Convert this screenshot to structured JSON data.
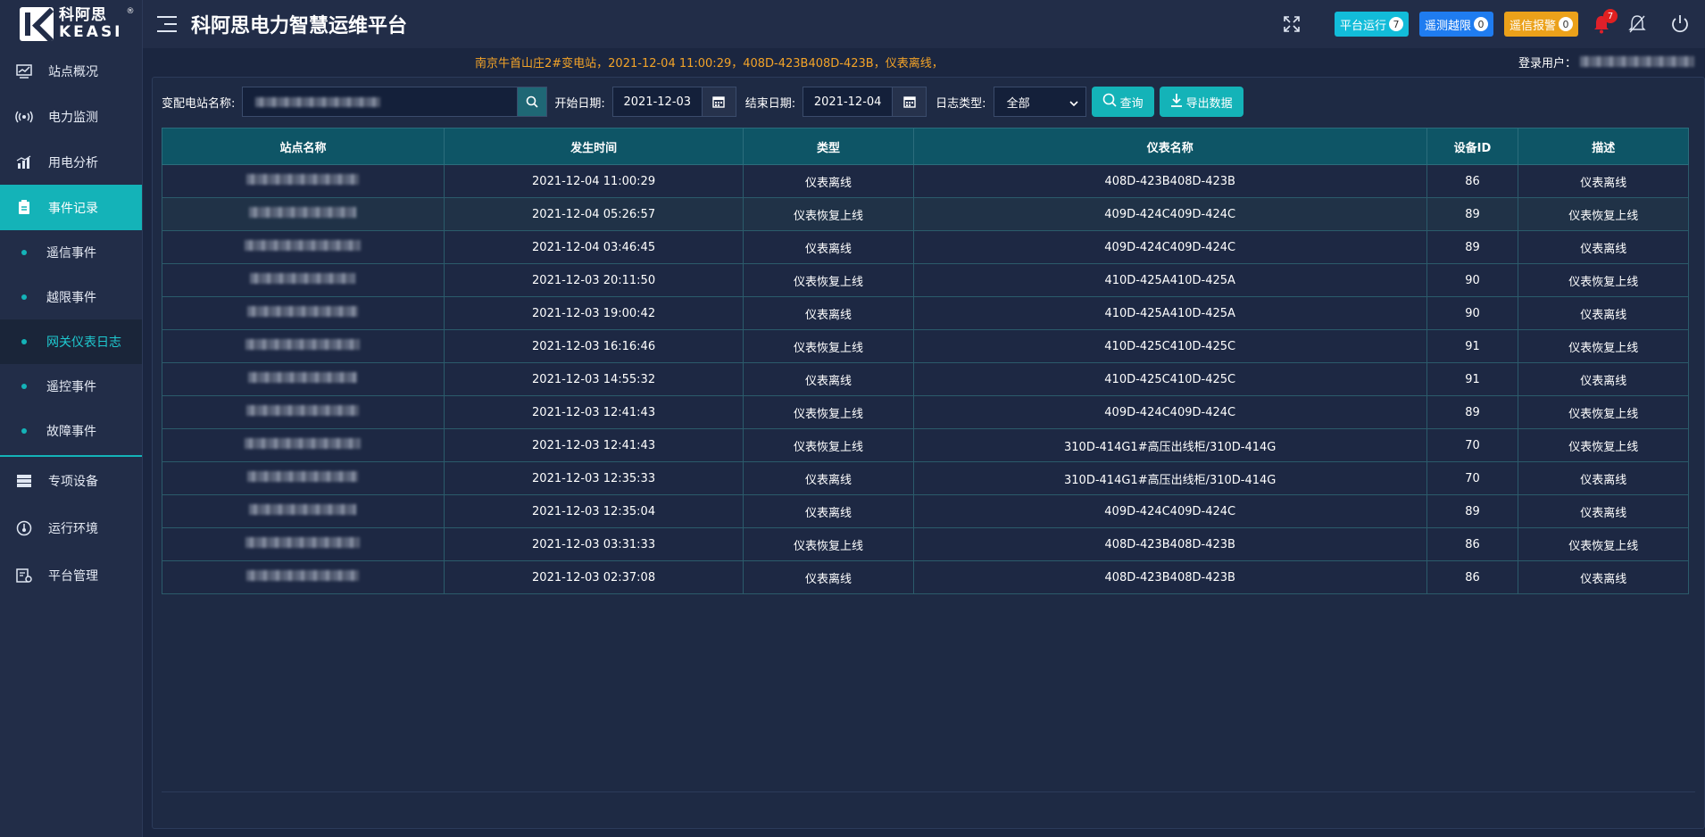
{
  "brand": {
    "cn": "科阿思",
    "en": "KEASI",
    "mark": "®"
  },
  "app_title": "科阿思电力智慧运维平台",
  "sidebar": {
    "items": [
      {
        "label": "站点概况",
        "icon": "chart-monitor-icon"
      },
      {
        "label": "电力监测",
        "icon": "signal-icon"
      },
      {
        "label": "用电分析",
        "icon": "bar-chart-icon"
      },
      {
        "label": "事件记录",
        "icon": "clipboard-icon",
        "active": true
      }
    ],
    "sub_items": [
      {
        "label": "遥信事件"
      },
      {
        "label": "越限事件"
      },
      {
        "label": "网关仪表日志",
        "active": true
      },
      {
        "label": "遥控事件"
      },
      {
        "label": "故障事件"
      }
    ],
    "bottom_items": [
      {
        "label": "专项设备",
        "icon": "server-icon"
      },
      {
        "label": "运行环境",
        "icon": "gauge-icon"
      },
      {
        "label": "平台管理",
        "icon": "settings-list-icon"
      }
    ]
  },
  "topbar": {
    "pills": [
      {
        "label": "平台运行",
        "count": "7",
        "color": "#12bcd9"
      },
      {
        "label": "遥测越限",
        "count": "0",
        "color": "#1f7cf0"
      },
      {
        "label": "遥信报警",
        "count": "0",
        "color": "#eba11a"
      }
    ],
    "bell_count": "7"
  },
  "ticker": {
    "message": "南京牛首山庄2#变电站，2021-12-04 11:00:29，408D-423B408D-423B，仪表离线，",
    "login_label": "登录用户："
  },
  "filters": {
    "station_label": "变配电站名称:",
    "start_label": "开始日期:",
    "start_date": "2021-12-03",
    "end_label": "结束日期:",
    "end_date": "2021-12-04",
    "type_label": "日志类型:",
    "type_value": "全部",
    "query_label": "查询",
    "export_label": "导出数据"
  },
  "table": {
    "columns": [
      "站点名称",
      "发生时间",
      "类型",
      "仪表名称",
      "设备ID",
      "描述"
    ],
    "rows": [
      [
        "2021-12-04 11:00:29",
        "仪表离线",
        "408D-423B408D-423B",
        "86",
        "仪表离线"
      ],
      [
        "2021-12-04 05:26:57",
        "仪表恢复上线",
        "409D-424C409D-424C",
        "89",
        "仪表恢复上线"
      ],
      [
        "2021-12-04 03:46:45",
        "仪表离线",
        "409D-424C409D-424C",
        "89",
        "仪表离线"
      ],
      [
        "2021-12-03 20:11:50",
        "仪表恢复上线",
        "410D-425A410D-425A",
        "90",
        "仪表恢复上线"
      ],
      [
        "2021-12-03 19:00:42",
        "仪表离线",
        "410D-425A410D-425A",
        "90",
        "仪表离线"
      ],
      [
        "2021-12-03 16:16:46",
        "仪表恢复上线",
        "410D-425C410D-425C",
        "91",
        "仪表恢复上线"
      ],
      [
        "2021-12-03 14:55:32",
        "仪表离线",
        "410D-425C410D-425C",
        "91",
        "仪表离线"
      ],
      [
        "2021-12-03 12:41:43",
        "仪表恢复上线",
        "409D-424C409D-424C",
        "89",
        "仪表恢复上线"
      ],
      [
        "2021-12-03 12:41:43",
        "仪表恢复上线",
        "310D-414G1#高压出线柜/310D-414G",
        "70",
        "仪表恢复上线"
      ],
      [
        "2021-12-03 12:35:33",
        "仪表离线",
        "310D-414G1#高压出线柜/310D-414G",
        "70",
        "仪表离线"
      ],
      [
        "2021-12-03 12:35:04",
        "仪表离线",
        "409D-424C409D-424C",
        "89",
        "仪表离线"
      ],
      [
        "2021-12-03 03:31:33",
        "仪表恢复上线",
        "408D-423B408D-423B",
        "86",
        "仪表恢复上线"
      ],
      [
        "2021-12-03 02:37:08",
        "仪表离线",
        "408D-423B408D-423B",
        "86",
        "仪表离线"
      ]
    ]
  }
}
